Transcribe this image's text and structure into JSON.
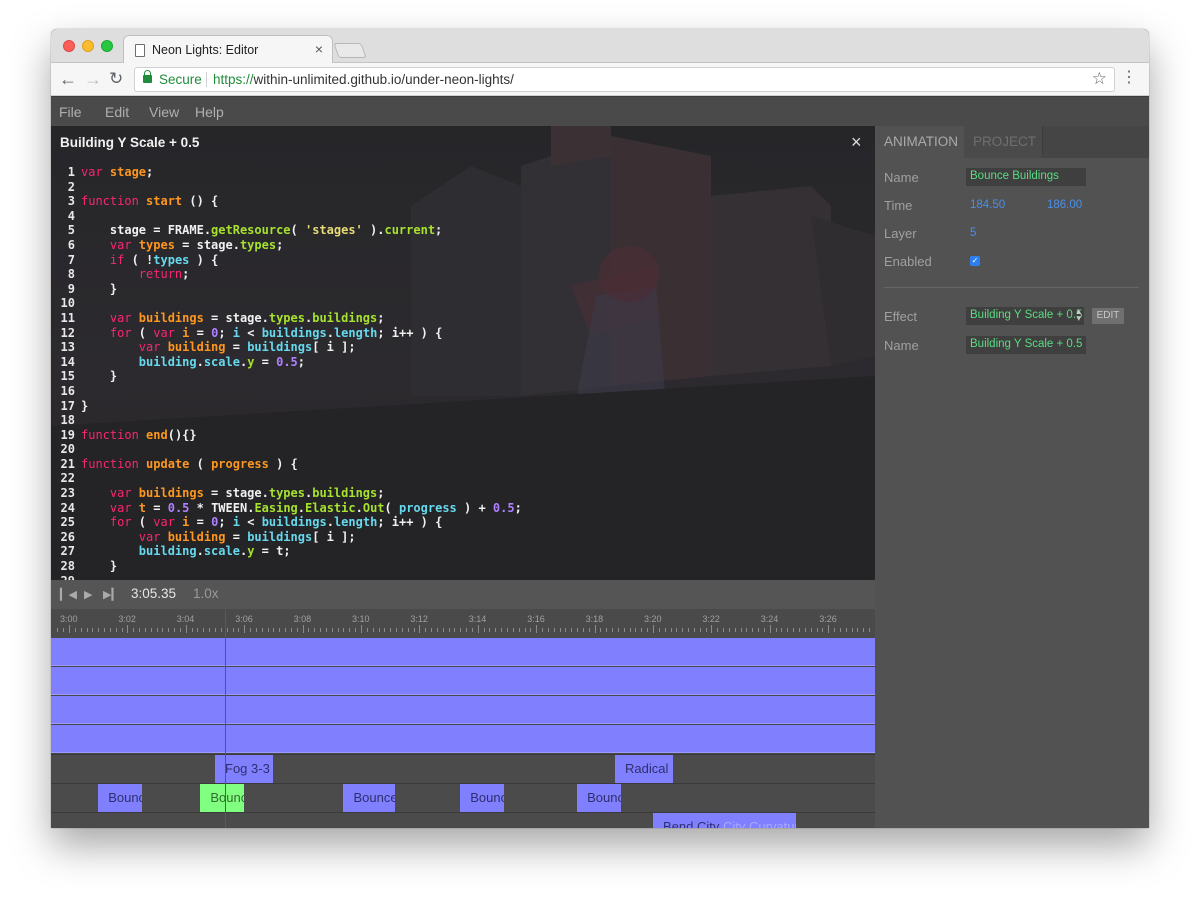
{
  "browser": {
    "tab_title": "Neon Lights: Editor",
    "tab_close": "×",
    "secure_label": "Secure",
    "url_scheme": "https://",
    "url_rest": "within-unlimited.github.io/under-neon-lights/"
  },
  "menu": [
    "File",
    "Edit",
    "View",
    "Help"
  ],
  "editor": {
    "title": "Building Y Scale + 0.5",
    "close": "×",
    "lines": [
      [
        {
          "t": "var ",
          "c": "kw"
        },
        {
          "t": "stage",
          "c": "orange"
        },
        {
          "t": ";",
          "c": ""
        }
      ],
      [],
      [
        {
          "t": "function ",
          "c": "kw"
        },
        {
          "t": "start",
          "c": "orange"
        },
        {
          "t": " () {",
          "c": ""
        }
      ],
      [],
      [
        {
          "t": "    stage = FRAME.",
          "c": ""
        },
        {
          "t": "getResource",
          "c": "fn"
        },
        {
          "t": "( ",
          "c": ""
        },
        {
          "t": "'stages'",
          "c": "str"
        },
        {
          "t": " ).",
          "c": ""
        },
        {
          "t": "current",
          "c": "fn"
        },
        {
          "t": ";",
          "c": ""
        }
      ],
      [
        {
          "t": "    var ",
          "c": "kw"
        },
        {
          "t": "types",
          "c": "orange"
        },
        {
          "t": " = stage.",
          "c": ""
        },
        {
          "t": "types",
          "c": "fn"
        },
        {
          "t": ";",
          "c": ""
        }
      ],
      [
        {
          "t": "    if ",
          "c": "kw"
        },
        {
          "t": "( !",
          "c": ""
        },
        {
          "t": "types",
          "c": "prop"
        },
        {
          "t": " ) {",
          "c": ""
        }
      ],
      [
        {
          "t": "        return",
          "c": "kw"
        },
        {
          "t": ";",
          "c": ""
        }
      ],
      [
        {
          "t": "    }",
          "c": ""
        }
      ],
      [],
      [
        {
          "t": "    var ",
          "c": "kw"
        },
        {
          "t": "buildings",
          "c": "orange"
        },
        {
          "t": " = stage.",
          "c": ""
        },
        {
          "t": "types",
          "c": "fn"
        },
        {
          "t": ".",
          "c": ""
        },
        {
          "t": "buildings",
          "c": "fn"
        },
        {
          "t": ";",
          "c": ""
        }
      ],
      [
        {
          "t": "    for ",
          "c": "kw"
        },
        {
          "t": "( ",
          "c": ""
        },
        {
          "t": "var ",
          "c": "kw"
        },
        {
          "t": "i",
          "c": "orange"
        },
        {
          "t": " = ",
          "c": ""
        },
        {
          "t": "0",
          "c": "num"
        },
        {
          "t": "; ",
          "c": ""
        },
        {
          "t": "i",
          "c": "prop"
        },
        {
          "t": " < ",
          "c": ""
        },
        {
          "t": "buildings",
          "c": "prop"
        },
        {
          "t": ".",
          "c": ""
        },
        {
          "t": "length",
          "c": "prop"
        },
        {
          "t": "; i++ ) {",
          "c": ""
        }
      ],
      [
        {
          "t": "        var ",
          "c": "kw"
        },
        {
          "t": "building",
          "c": "orange"
        },
        {
          "t": " = ",
          "c": ""
        },
        {
          "t": "buildings",
          "c": "prop"
        },
        {
          "t": "[ i ];",
          "c": ""
        }
      ],
      [
        {
          "t": "        ",
          "c": ""
        },
        {
          "t": "building",
          "c": "prop"
        },
        {
          "t": ".",
          "c": ""
        },
        {
          "t": "scale",
          "c": "prop"
        },
        {
          "t": ".",
          "c": ""
        },
        {
          "t": "y",
          "c": "fn"
        },
        {
          "t": " = ",
          "c": ""
        },
        {
          "t": "0.5",
          "c": "num"
        },
        {
          "t": ";",
          "c": ""
        }
      ],
      [
        {
          "t": "    }",
          "c": ""
        }
      ],
      [],
      [
        {
          "t": "}",
          "c": ""
        }
      ],
      [],
      [
        {
          "t": "function ",
          "c": "kw"
        },
        {
          "t": "end",
          "c": "orange"
        },
        {
          "t": "(){}",
          "c": ""
        }
      ],
      [],
      [
        {
          "t": "function ",
          "c": "kw"
        },
        {
          "t": "update",
          "c": "orange"
        },
        {
          "t": " ( ",
          "c": ""
        },
        {
          "t": "progress",
          "c": "orange"
        },
        {
          "t": " ) {",
          "c": ""
        }
      ],
      [],
      [
        {
          "t": "    var ",
          "c": "kw"
        },
        {
          "t": "buildings",
          "c": "orange"
        },
        {
          "t": " = stage.",
          "c": ""
        },
        {
          "t": "types",
          "c": "fn"
        },
        {
          "t": ".",
          "c": ""
        },
        {
          "t": "buildings",
          "c": "fn"
        },
        {
          "t": ";",
          "c": ""
        }
      ],
      [
        {
          "t": "    var ",
          "c": "kw"
        },
        {
          "t": "t",
          "c": "orange"
        },
        {
          "t": " = ",
          "c": ""
        },
        {
          "t": "0.5",
          "c": "num"
        },
        {
          "t": " * TWEEN.",
          "c": ""
        },
        {
          "t": "Easing",
          "c": "fn"
        },
        {
          "t": ".",
          "c": ""
        },
        {
          "t": "Elastic",
          "c": "fn"
        },
        {
          "t": ".",
          "c": ""
        },
        {
          "t": "Out",
          "c": "fn"
        },
        {
          "t": "( ",
          "c": ""
        },
        {
          "t": "progress",
          "c": "prop"
        },
        {
          "t": " ) + ",
          "c": ""
        },
        {
          "t": "0.5",
          "c": "num"
        },
        {
          "t": ";",
          "c": ""
        }
      ],
      [
        {
          "t": "    for ",
          "c": "kw"
        },
        {
          "t": "( ",
          "c": ""
        },
        {
          "t": "var ",
          "c": "kw"
        },
        {
          "t": "i",
          "c": "orange"
        },
        {
          "t": " = ",
          "c": ""
        },
        {
          "t": "0",
          "c": "num"
        },
        {
          "t": "; ",
          "c": ""
        },
        {
          "t": "i",
          "c": "prop"
        },
        {
          "t": " < ",
          "c": ""
        },
        {
          "t": "buildings",
          "c": "prop"
        },
        {
          "t": ".",
          "c": ""
        },
        {
          "t": "length",
          "c": "prop"
        },
        {
          "t": "; i++ ) {",
          "c": ""
        }
      ],
      [
        {
          "t": "        var ",
          "c": "kw"
        },
        {
          "t": "building",
          "c": "orange"
        },
        {
          "t": " = ",
          "c": ""
        },
        {
          "t": "buildings",
          "c": "prop"
        },
        {
          "t": "[ i ];",
          "c": ""
        }
      ],
      [
        {
          "t": "        ",
          "c": ""
        },
        {
          "t": "building",
          "c": "prop"
        },
        {
          "t": ".",
          "c": ""
        },
        {
          "t": "scale",
          "c": "prop"
        },
        {
          "t": ".",
          "c": ""
        },
        {
          "t": "y",
          "c": "fn"
        },
        {
          "t": " = t;",
          "c": ""
        }
      ],
      [
        {
          "t": "    }",
          "c": ""
        }
      ],
      []
    ]
  },
  "transport": {
    "time": "3:05.35",
    "speed": "1.0x"
  },
  "ruler": {
    "labels": [
      "3:00",
      "3:02",
      "3:04",
      "3:06",
      "3:08",
      "3:10",
      "3:12",
      "3:14",
      "3:16",
      "3:18",
      "3:20",
      "3:22",
      "3:24",
      "3:26"
    ]
  },
  "timeline": {
    "playhead_time": "3:05.35",
    "clips": [
      {
        "label": "Fog 3-3",
        "muted": "",
        "row": 0,
        "start": "3:05.00",
        "end": "3:07.00",
        "active": false
      },
      {
        "label": "Radical",
        "muted": "",
        "row": 0,
        "start": "3:18.70",
        "end": "3:20.70",
        "active": false
      },
      {
        "label": "Bounce Buildings",
        "muted": "",
        "row": 1,
        "start": "3:01.00",
        "end": "3:02.50",
        "active": false
      },
      {
        "label": "Bounce Buildings",
        "muted": "",
        "row": 1,
        "start": "3:04.50",
        "end": "3:06.00",
        "active": true
      },
      {
        "label": "Bounce Buildings",
        "muted": "",
        "row": 1,
        "start": "3:09.40",
        "end": "3:11.15",
        "active": false
      },
      {
        "label": "Bounce Buildings",
        "muted": "",
        "row": 1,
        "start": "3:13.40",
        "end": "3:14.90",
        "active": false
      },
      {
        "label": "Bounce Buildings",
        "muted": "",
        "row": 1,
        "start": "3:17.40",
        "end": "3:18.90",
        "active": false
      },
      {
        "label": "Bend City ",
        "muted": "City Curvature",
        "row": 2,
        "start": "3:20.00",
        "end": "3:24.90",
        "active": false
      }
    ]
  },
  "panel": {
    "tab_animation": "ANIMATION",
    "tab_project": "PROJECT",
    "name_label": "Name",
    "name_value": "Bounce Buildings",
    "time_label": "Time",
    "time_start": "184.50",
    "time_end": "186.00",
    "layer_label": "Layer",
    "layer_value": "5",
    "enabled_label": "Enabled",
    "enabled": true,
    "effect_label": "Effect",
    "effect_value": "Building Y Scale + 0.5",
    "edit_button": "EDIT",
    "effect_name_label": "Name",
    "effect_name_value": "Building Y Scale + 0.5"
  },
  "colors": {
    "track": "#8080ff",
    "active_clip": "#80ff80",
    "playhead": "#e02020",
    "field_text": "#5adc82",
    "number_text": "#4a8fe8"
  }
}
